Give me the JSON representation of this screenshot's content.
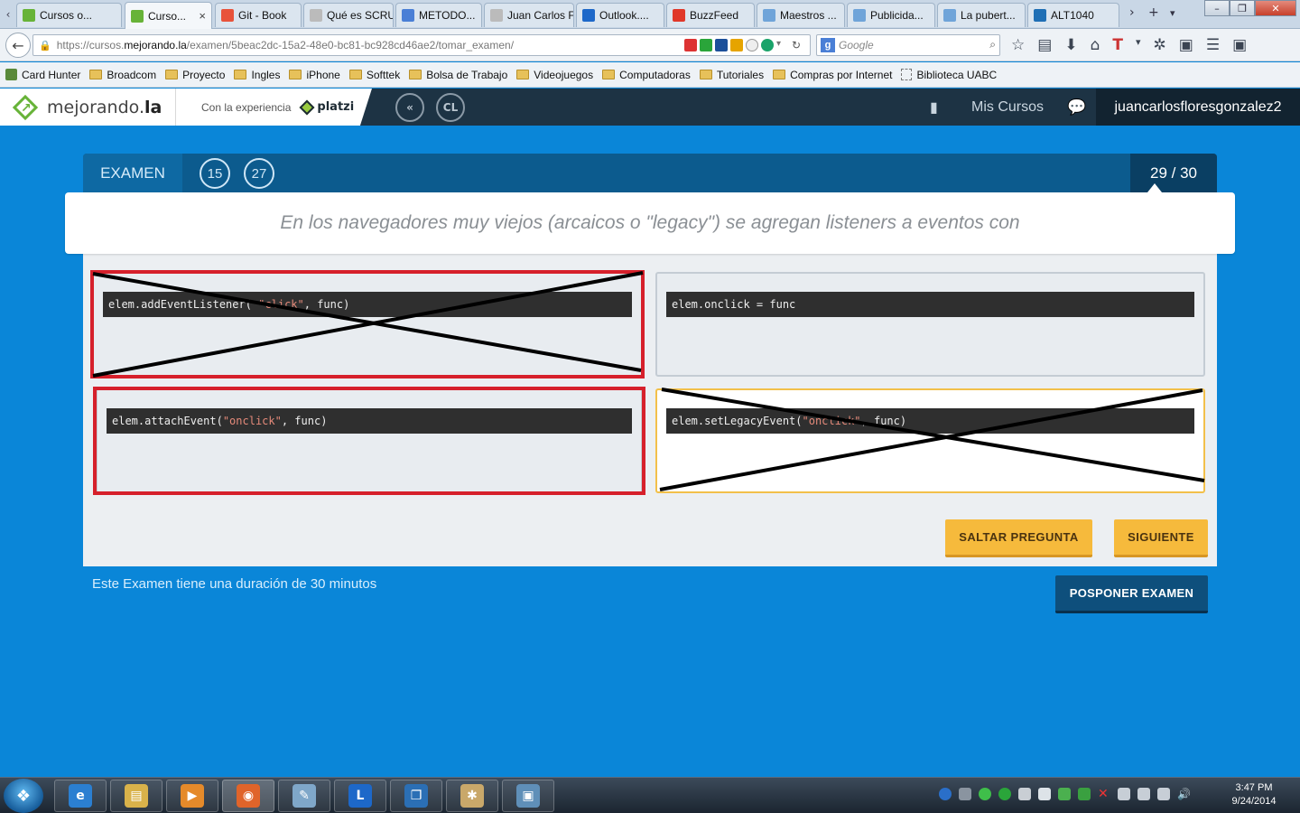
{
  "browser": {
    "tabs": [
      {
        "label": "Cursos o...",
        "favicon": "mejorando-icon",
        "color": "#67b338",
        "active": false
      },
      {
        "label": "Curso...",
        "favicon": "mejorando-icon",
        "color": "#67b338",
        "active": true,
        "close": "×"
      },
      {
        "label": "Git - Book",
        "favicon": "git-icon",
        "color": "#e8533b",
        "active": false
      },
      {
        "label": "Qué es SCRU...",
        "favicon": "page-icon",
        "color": "#bbbbbb",
        "active": false
      },
      {
        "label": "METODO...",
        "favicon": "globe-icon",
        "color": "#4a7fd6",
        "active": false
      },
      {
        "label": "Juan Carlos Fl...",
        "favicon": "page-icon",
        "color": "#bbbbbb",
        "active": false
      },
      {
        "label": "Outlook....",
        "favicon": "outlook-icon",
        "color": "#1d68c9",
        "active": false
      },
      {
        "label": "BuzzFeed",
        "favicon": "buzzfeed-icon",
        "color": "#e0382a",
        "active": false
      },
      {
        "label": "Maestros ...",
        "favicon": "mh-icon",
        "color": "#6fa4d9",
        "active": false
      },
      {
        "label": "Publicida...",
        "favicon": "mh-icon",
        "color": "#6fa4d9",
        "active": false
      },
      {
        "label": "La pubert...",
        "favicon": "mh-icon",
        "color": "#6fa4d9",
        "active": false
      },
      {
        "label": "ALT1040",
        "favicon": "alt1040-icon",
        "color": "#1f6fb5",
        "active": false
      }
    ],
    "url_prefix": "https://cursos.",
    "url_domain": "mejorando.la",
    "url_path": "/examen/5beac2dc-15a2-48e0-bc81-bc928cd46ae2/tomar_examen/",
    "search_engine_label": "g",
    "search_placeholder": "Google",
    "bookmarks": [
      {
        "label": "Card Hunter",
        "type": "page-icon"
      },
      {
        "label": "Broadcom",
        "type": "folder-icon"
      },
      {
        "label": "Proyecto",
        "type": "folder-icon"
      },
      {
        "label": "Ingles",
        "type": "folder-icon"
      },
      {
        "label": "iPhone",
        "type": "folder-icon"
      },
      {
        "label": "Softtek",
        "type": "folder-icon"
      },
      {
        "label": "Bolsa de Trabajo",
        "type": "folder-icon"
      },
      {
        "label": "Videojuegos",
        "type": "folder-icon"
      },
      {
        "label": "Computadoras",
        "type": "folder-icon"
      },
      {
        "label": "Tutoriales",
        "type": "folder-icon"
      },
      {
        "label": "Compras por Internet",
        "type": "folder-icon"
      },
      {
        "label": "Biblioteca UABC",
        "type": "page-icon"
      }
    ]
  },
  "site": {
    "logo_prefix": "mejorando.",
    "logo_suffix": "la",
    "partner_label": "Con la experiencia",
    "partner_name": "platzi",
    "icon_back_label": "«",
    "icon_cl_label": "CL",
    "nav_my_courses": "Mis Cursos",
    "username": "juancarlosfloresgonzalez2"
  },
  "exam": {
    "label": "EXAMEN",
    "counter_a": "15",
    "counter_b": "27",
    "progress": "29 / 30",
    "question": "En los navegadores muy viejos (arcaicos o \"legacy\") se agregan listeners a eventos con",
    "options": [
      {
        "pre": "elem.addEventListener( ",
        "str": "\"click\"",
        "post": ", func)",
        "state": "crossed"
      },
      {
        "pre": "elem.onclick = func",
        "str": "",
        "post": "",
        "state": "normal"
      },
      {
        "pre": "elem.attachEvent(",
        "str": "\"onclick\"",
        "post": ", func)",
        "state": "framed"
      },
      {
        "pre": "elem.setLegacyEvent(",
        "str": "\"onclick\"",
        "post": ", func)",
        "state": "selected-crossed"
      }
    ],
    "skip_label": "SALTAR PREGUNTA",
    "next_label": "SIGUIENTE",
    "duration_text": "Este Examen tiene una duración de 30 minutos",
    "postpone_label": "POSPONER EXAMEN"
  },
  "taskbar": {
    "time": "3:47 PM",
    "date": "9/24/2014",
    "items": [
      {
        "name": "internet-explorer-icon",
        "glyph": "e",
        "color": "#2b7fd1"
      },
      {
        "name": "file-explorer-icon",
        "glyph": "▤",
        "color": "#d9b24a"
      },
      {
        "name": "media-player-icon",
        "glyph": "▶",
        "color": "#e58a2a"
      },
      {
        "name": "firefox-icon",
        "glyph": "◉",
        "color": "#e0642a"
      },
      {
        "name": "notepad-icon",
        "glyph": "✎",
        "color": "#7fa7c9"
      },
      {
        "name": "lync-icon",
        "glyph": "L",
        "color": "#1d68c9"
      },
      {
        "name": "remote-desktop-icon",
        "glyph": "❐",
        "color": "#2b6fb5"
      },
      {
        "name": "paint-icon",
        "glyph": "✱",
        "color": "#c9a86a"
      },
      {
        "name": "photo-viewer-icon",
        "glyph": "▣",
        "color": "#5f8fb8"
      }
    ]
  },
  "colors": {
    "page_bg": "#0a86d8",
    "header_bg": "#1d3344",
    "accent_green": "#67b338",
    "accent_yellow": "#f6ba3c",
    "wrong_red": "#d6202b",
    "dark_blue": "#0e4f7c"
  }
}
